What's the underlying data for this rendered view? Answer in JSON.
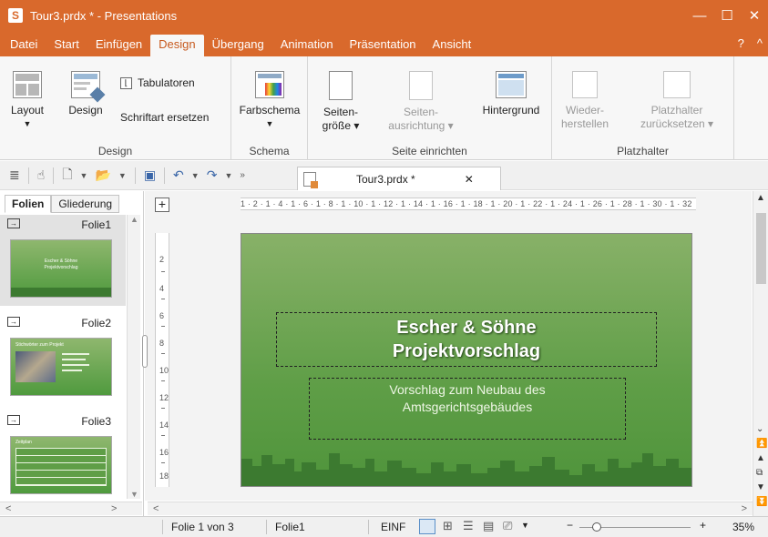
{
  "window": {
    "title": "Tour3.prdx * - Presentations",
    "app_badge": "S"
  },
  "window_controls": {
    "minimize": "—",
    "maximize": "☐",
    "close": "✕"
  },
  "menu": {
    "tabs": [
      "Datei",
      "Start",
      "Einfügen",
      "Design",
      "Übergang",
      "Animation",
      "Präsentation",
      "Ansicht"
    ],
    "active": "Design",
    "help": "?",
    "collapse": "^"
  },
  "ribbon": {
    "groups": {
      "design": "Design",
      "schema": "Schema",
      "seite": "Seite einrichten",
      "platzhalter": "Platzhalter"
    },
    "buttons": {
      "layout": "Layout",
      "design": "Design",
      "tabulatoren": "Tabulatoren",
      "schriftart": "Schriftart ersetzen",
      "farbschema": "Farbschema",
      "seitengroesse_1": "Seiten-",
      "seitengroesse_2": "größe ▾",
      "ausrichtung_1": "Seiten-",
      "ausrichtung_2": "ausrichtung ▾",
      "hintergrund": "Hintergrund",
      "wiederherstellen_1": "Wieder-",
      "wiederherstellen_2": "herstellen",
      "platzhalter_1": "Platzhalter",
      "platzhalter_2": "zurücksetzen ▾"
    }
  },
  "document_tab": {
    "name": "Tour3.prdx *",
    "close": "✕"
  },
  "left_panel": {
    "tabs": [
      "Folien",
      "Gliederung"
    ],
    "slides": [
      {
        "name": "Folie1",
        "thumb_title": "Escher & Söhne",
        "thumb_sub": "Projektvorschlag"
      },
      {
        "name": "Folie2",
        "thumb_title": "Stichwörter zum Projekt"
      },
      {
        "name": "Folie3",
        "thumb_title": "Zeitplan"
      }
    ]
  },
  "ruler": {
    "horizontal": "1 · 2 · 1 · 4 · 1 · 6 · 1 · 8 · 1 · 10 · 1 · 12 · 1 · 14 · 1 · 16 · 1 · 18 · 1 · 20 · 1 · 22 · 1 · 24 · 1 · 26 · 1 · 28 · 1 · 30 · 1 · 32",
    "vertical": [
      "2",
      "4",
      "6",
      "8",
      "10",
      "12",
      "14",
      "16",
      "18"
    ]
  },
  "slide": {
    "title_line1": "Escher & Söhne",
    "title_line2": "Projektvorschlag",
    "subtitle_line1": "Vorschlag zum Neubau des",
    "subtitle_line2": "Amtsgerichtsgebäudes"
  },
  "status": {
    "slide_pos": "Folie 1 von 3",
    "slide_name": "Folie1",
    "mode": "EINF",
    "zoom": "35%",
    "zoom_minus": "−",
    "zoom_plus": "+"
  },
  "colors": {
    "accent": "#d9692c",
    "slide_green": "#5f9e47",
    "skyline": "#3c7a30"
  }
}
